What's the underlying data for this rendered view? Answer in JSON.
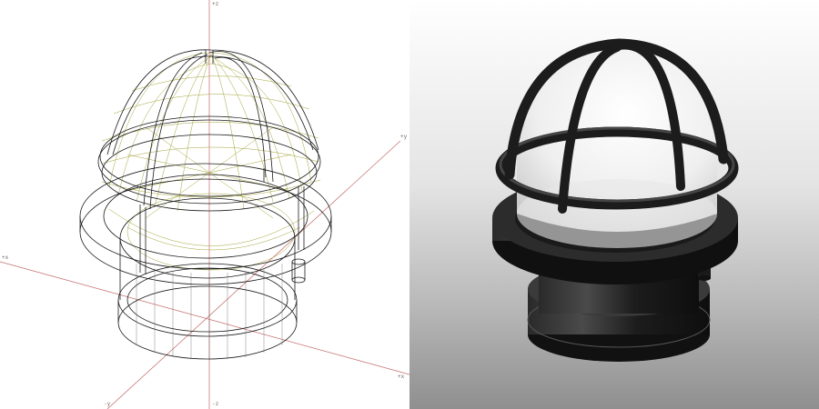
{
  "wireframe_view": {
    "axis_labels": {
      "z_top": "+z",
      "z_bottom": "-z",
      "x_left": "+x",
      "x_right": "+x",
      "y_right": "+y",
      "y_bottom": "-y"
    },
    "colors": {
      "axis": "#c46a6a",
      "structure": "#1a1a1a",
      "dome_lines": "#9a9a30"
    }
  },
  "render_view": {
    "colors": {
      "background_top": "#ffffff",
      "background_bottom": "#8f8f8f",
      "metal": "#1e1e1e",
      "dome": "#f2f2f2"
    }
  }
}
